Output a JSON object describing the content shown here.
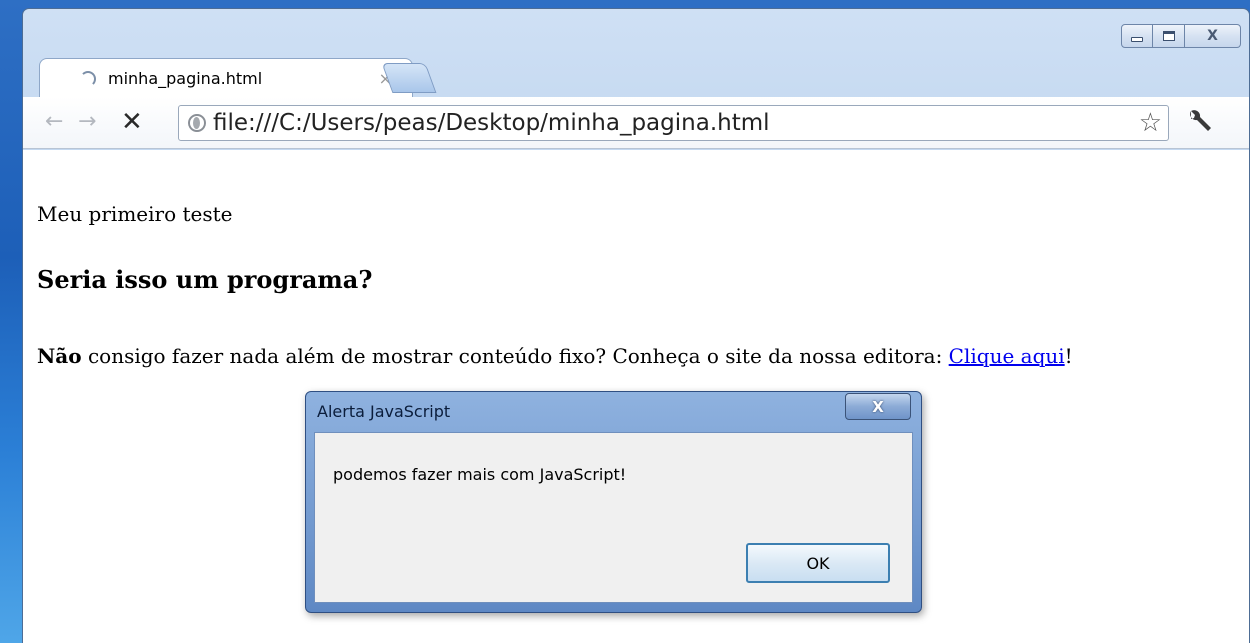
{
  "browser": {
    "tab": {
      "title": "minha_pagina.html",
      "close_glyph": "×"
    },
    "toolbar": {
      "back_glyph": "←",
      "forward_glyph": "→",
      "stop_glyph": "✕",
      "url": "file:///C:/Users/peas/Desktop/minha_pagina.html",
      "star_glyph": "☆"
    },
    "window_controls": {
      "close_glyph": "X"
    }
  },
  "page": {
    "line1": "Meu primeiro teste",
    "heading": "Seria isso um programa?",
    "para_bold": "Não",
    "para_text": " consigo fazer nada além de mostrar conteúdo fixo? Conheça o site da nossa editora: ",
    "link_text": "Clique aqui",
    "para_end": "!"
  },
  "dialog": {
    "title": "Alerta JavaScript",
    "close_glyph": "X",
    "message": "podemos fazer mais com JavaScript!",
    "ok_label": "OK"
  },
  "colors": {
    "link": "#0000ee",
    "window_frame": "#b9d1ee",
    "dialog_frame": "#5e88c4"
  },
  "icons": [
    "loading-spinner-icon",
    "back-arrow-icon",
    "forward-arrow-icon",
    "stop-icon",
    "globe-icon",
    "star-icon",
    "wrench-icon",
    "minimize-icon",
    "maximize-icon",
    "close-icon"
  ]
}
